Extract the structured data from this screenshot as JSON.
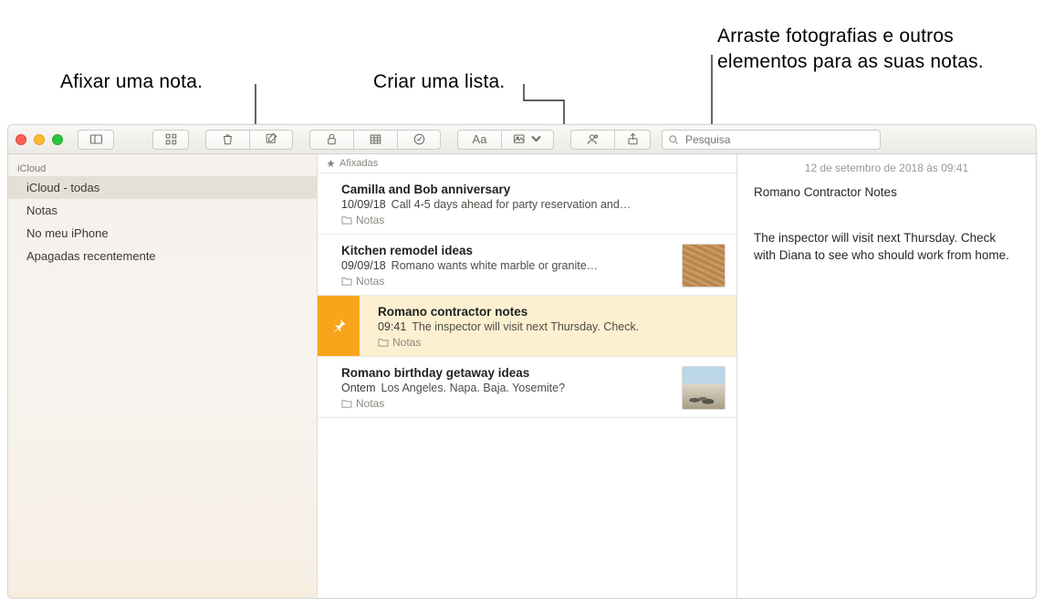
{
  "callouts": {
    "pin": "Afixar uma nota.",
    "list": "Criar uma lista.",
    "drag": "Arraste fotografias e outros elementos para as suas notas."
  },
  "search": {
    "placeholder": "Pesquisa"
  },
  "sidebar": {
    "header": "iCloud",
    "items": [
      {
        "label": "iCloud - todas",
        "selected": true
      },
      {
        "label": "Notas"
      },
      {
        "label": "No meu iPhone"
      },
      {
        "label": "Apagadas recentemente"
      }
    ]
  },
  "pins_label": "Afixadas",
  "notes": [
    {
      "title": "Camilla and Bob anniversary",
      "date": "10/09/18",
      "preview": "Call 4-5 days ahead for party reservation and…",
      "folder": "Notas"
    },
    {
      "title": "Kitchen remodel ideas",
      "date": "09/09/18",
      "preview": "Romano wants white marble or granite…",
      "folder": "Notas",
      "thumb": "wood"
    },
    {
      "title": "Romano contractor notes",
      "date": "09:41",
      "preview": "The inspector will visit next Thursday. Check.",
      "folder": "Notas",
      "selected": true
    },
    {
      "title": "Romano birthday getaway ideas",
      "date": "Ontem",
      "preview": "Los Angeles. Napa. Baja. Yosemite?",
      "folder": "Notas",
      "thumb": "beach"
    }
  ],
  "detail": {
    "timestamp": "12 de setembro de 2018 às 09:41",
    "title": "Romano Contractor Notes",
    "body": "The inspector will visit next Thursday. Check with Diana to see who should work from home."
  }
}
